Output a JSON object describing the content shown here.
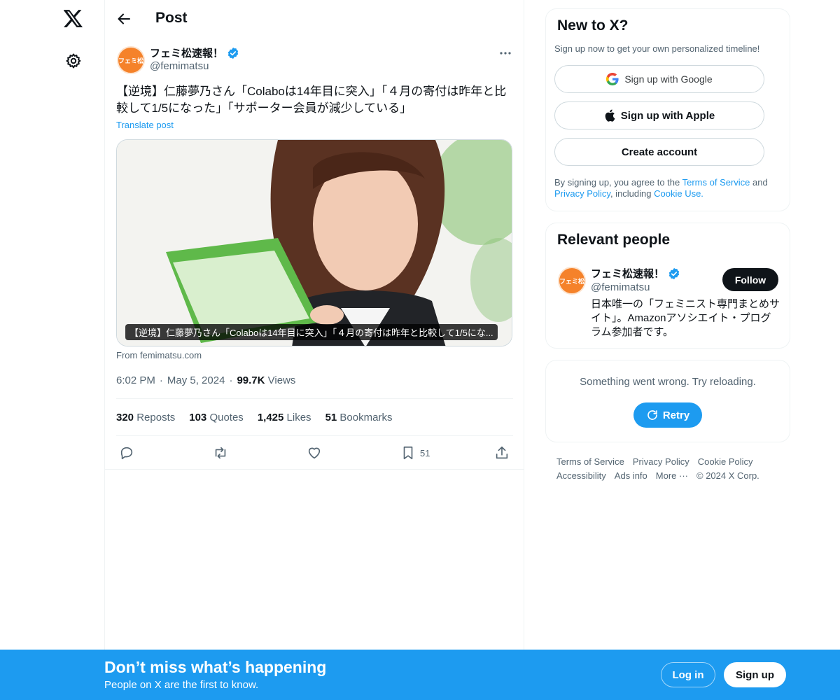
{
  "header": {
    "title": "Post"
  },
  "post": {
    "author": {
      "name": "フェミ松速報！",
      "handle": "@femimatsu",
      "avatar_text": "フェミ松"
    },
    "text": "【逆境】仁藤夢乃さん「Colaboは14年目に突入」「４月の寄付は昨年と比較して1/5になった」「サポーター会員が減少している」",
    "translate_label": "Translate post",
    "card": {
      "caption": "【逆境】仁藤夢乃さん「Colaboは14年目に突入」「４月の寄付は昨年と比較して1/5にな...",
      "source": "From femimatsu.com"
    },
    "meta": {
      "time": "6:02 PM",
      "sep1": "·",
      "date": "May 5, 2024",
      "sep2": "·",
      "views_count": "99.7K",
      "views_label": "Views"
    },
    "stats": [
      {
        "count": "320",
        "label": "Reposts"
      },
      {
        "count": "103",
        "label": "Quotes"
      },
      {
        "count": "1,425",
        "label": "Likes"
      },
      {
        "count": "51",
        "label": "Bookmarks"
      }
    ],
    "bookmark_count": "51"
  },
  "signup_box": {
    "title": "New to X?",
    "subtitle": "Sign up now to get your own personalized timeline!",
    "google_label": "Sign up with Google",
    "apple_label": "Sign up with Apple",
    "create_label": "Create account",
    "legal_pre": "By signing up, you agree to the ",
    "terms": "Terms of Service",
    "and": " and ",
    "privacy": "Privacy Policy",
    "including": ", including ",
    "cookie": "Cookie Use."
  },
  "relevant": {
    "title": "Relevant people",
    "name": "フェミ松速報！",
    "handle": "@femimatsu",
    "bio": "日本唯一の「フェミニスト専門まとめサイト」。Amazonアソシエイト・プログラム参加者です。",
    "follow_label": "Follow"
  },
  "error_box": {
    "message": "Something went wrong. Try reloading.",
    "retry_label": "Retry"
  },
  "footer": {
    "links": [
      "Terms of Service",
      "Privacy Policy",
      "Cookie Policy",
      "Accessibility",
      "Ads info",
      "More ···"
    ],
    "copyright": "© 2024 X Corp."
  },
  "banner": {
    "title": "Don’t miss what’s happening",
    "subtitle": "People on X are the first to know.",
    "login_label": "Log in",
    "signup_label": "Sign up"
  },
  "colors": {
    "accent": "#1d9bf0",
    "text": "#0f1419",
    "muted": "#536471",
    "brand_orange": "#f5822a"
  }
}
